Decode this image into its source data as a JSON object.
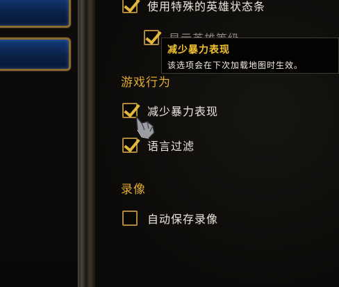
{
  "options": {
    "hero_status_bar": {
      "label": "使用特殊的英雄状态条",
      "checked": true
    },
    "hero_level": {
      "label": "显示英雄等级",
      "checked": true
    }
  },
  "sections": {
    "gameplay": {
      "title": "游戏行为",
      "items": [
        {
          "label": "减少暴力表现",
          "checked": true
        },
        {
          "label": "语言过滤",
          "checked": true
        }
      ]
    },
    "replay": {
      "title": "录像",
      "items": [
        {
          "label": "自动保存录像",
          "checked": false
        }
      ]
    }
  },
  "tooltip": {
    "title": "减少暴力表现",
    "body": "该选项会在下次加载地图时生效。"
  },
  "colors": {
    "accent": "#e0ac2f",
    "checkbox_border": "#b08a3a",
    "button_blue": "#0b2147"
  }
}
